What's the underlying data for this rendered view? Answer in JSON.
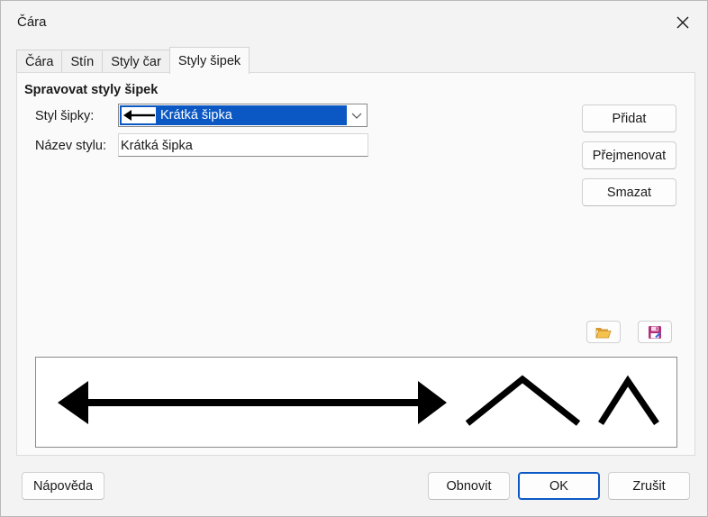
{
  "window": {
    "title": "Čára"
  },
  "tabs": [
    {
      "label": "Čára",
      "active": false
    },
    {
      "label": "Stín",
      "active": false
    },
    {
      "label": "Styly čar",
      "active": false
    },
    {
      "label": "Styly šipek",
      "active": true
    }
  ],
  "panel": {
    "section_title": "Spravovat styly šipek",
    "arrow_style_label": "Styl šipky:",
    "arrow_style_value": "Krátká šipka",
    "style_name_label": "Název stylu:",
    "style_name_value": "Krátká šipka",
    "buttons": {
      "add": "Přidat",
      "rename": "Přejmenovat",
      "delete": "Smazat"
    },
    "icons": {
      "load": "folder-open-icon",
      "save": "save-icon"
    }
  },
  "footer": {
    "help": "Nápověda",
    "reset": "Obnovit",
    "ok": "OK",
    "cancel": "Zrušit"
  },
  "colors": {
    "accent": "#0b58c4",
    "background": "#f3f3f3",
    "panel": "#fafafa"
  }
}
